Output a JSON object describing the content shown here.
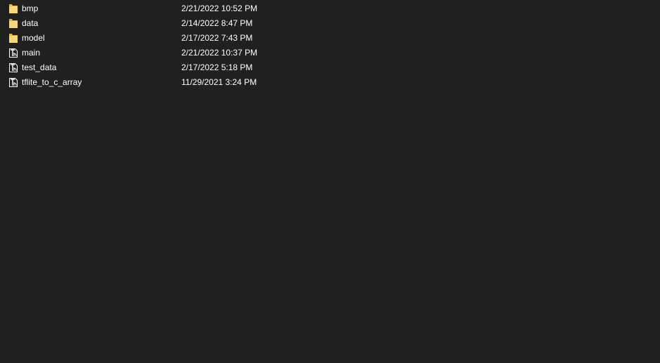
{
  "files": [
    {
      "name": "bmp",
      "modified": "2/21/2022 10:52 PM",
      "type": "folder"
    },
    {
      "name": "data",
      "modified": "2/14/2022 8:47 PM",
      "type": "folder"
    },
    {
      "name": "model",
      "modified": "2/17/2022 7:43 PM",
      "type": "folder"
    },
    {
      "name": "main",
      "modified": "2/21/2022 10:37 PM",
      "type": "python-file"
    },
    {
      "name": "test_data",
      "modified": "2/17/2022 5:18 PM",
      "type": "python-file"
    },
    {
      "name": "tflite_to_c_array",
      "modified": "11/29/2021 3:24 PM",
      "type": "python-file"
    }
  ],
  "icons": {
    "folder": "folder-icon",
    "python-file": "python-file-icon"
  },
  "colors": {
    "background": "#202020",
    "text": "#ffffff",
    "folder": "#f8d775",
    "folder_dark": "#e8b53c"
  }
}
